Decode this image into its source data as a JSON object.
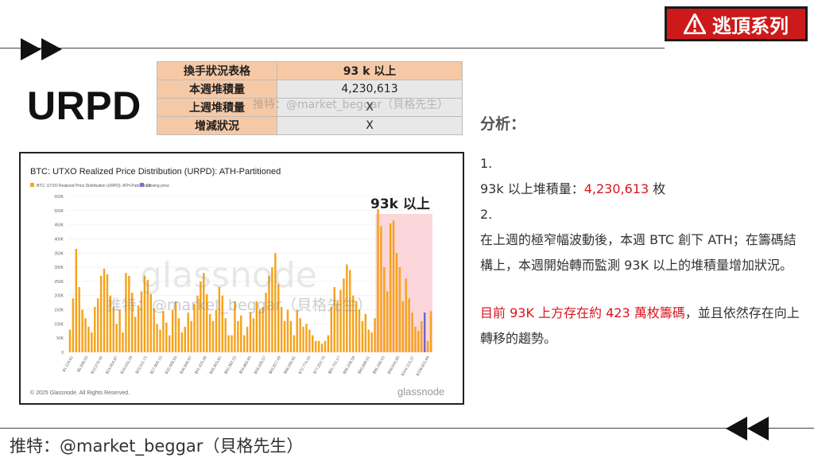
{
  "badge": {
    "text": "逃頂系列",
    "icon": "warning-triangle-icon"
  },
  "page": {
    "title": "URPD"
  },
  "summary_table": {
    "header_label": "換手狀況表格",
    "header_value": "93 k 以上",
    "rows": [
      {
        "label": "本週堆積量",
        "value": "4,230,613"
      },
      {
        "label": "上週堆積量",
        "value": "X"
      },
      {
        "label": "增減狀況",
        "value": "X"
      }
    ]
  },
  "watermarks": {
    "table": "推特：@market_beggar（貝格先生）",
    "chart": "推特：@market_beggar（貝格先生）",
    "chart_logo": "glassnode"
  },
  "chart_data": {
    "type": "bar",
    "title": "BTC: UTXO Realized Price Distribution (URPD): ATH-Partitioned",
    "legend": [
      "BTC: UTXO Realized Price Distribution (URPD): ATH-Partitioned",
      "Closing price"
    ],
    "highlight_label": "93k 以上",
    "ylim": [
      0,
      550000
    ],
    "y_ticks": [
      "0",
      "50K",
      "100K",
      "150K",
      "200K",
      "250K",
      "300K",
      "350K",
      "400K",
      "450K",
      "500K",
      "550K"
    ],
    "x_tick_labels": [
      "$1,119.61",
      "$5,598.03",
      "$10,076.45",
      "$14,554.87",
      "$19,033.29",
      "$23,511.71",
      "$27,990.13",
      "$32,468.55",
      "$36,946.97",
      "$41,425.39",
      "$45,903.81",
      "$50,382.23",
      "$54,860.65",
      "$59,339.07",
      "$63,817.49",
      "$68,295.91",
      "$72,774.33",
      "$77,252.75",
      "$81,731.17",
      "$86,209.59",
      "$90,688.01",
      "$95,166.43",
      "$99,644.85",
      "$104,123.27",
      "$108,601.69"
    ],
    "values": [
      80000,
      190000,
      365000,
      230000,
      150000,
      120000,
      90000,
      70000,
      160000,
      190000,
      270000,
      295000,
      275000,
      200000,
      160000,
      100000,
      150000,
      70000,
      280000,
      270000,
      210000,
      125000,
      165000,
      215000,
      270000,
      255000,
      205000,
      155000,
      100000,
      80000,
      145000,
      105000,
      60000,
      150000,
      180000,
      120000,
      70000,
      90000,
      140000,
      110000,
      170000,
      200000,
      250000,
      280000,
      205000,
      135000,
      110000,
      150000,
      230000,
      200000,
      120000,
      60000,
      60000,
      180000,
      110000,
      130000,
      60000,
      90000,
      140000,
      120000,
      180000,
      150000,
      160000,
      210000,
      270000,
      300000,
      350000,
      240000,
      160000,
      110000,
      150000,
      110000,
      60000,
      150000,
      120000,
      90000,
      100000,
      80000,
      60000,
      40000,
      40000,
      30000,
      40000,
      60000,
      160000,
      230000,
      180000,
      220000,
      260000,
      310000,
      290000,
      200000,
      180000,
      150000,
      110000,
      135000,
      80000,
      70000,
      120000,
      505000,
      445000,
      300000,
      215000,
      455000,
      465000,
      350000,
      300000,
      180000,
      260000,
      190000,
      140000,
      90000,
      75000,
      110000,
      140000,
      40000,
      145000
    ],
    "highlight_from_index": 99,
    "special_bar_index": 114,
    "footer_left": "© 2025 Glassnode. All Rights Reserved.",
    "footer_right": "glassnode"
  },
  "analysis": {
    "heading": "分析：",
    "item1_number": "1.",
    "item1_prefix": "93k 以上堆積量：",
    "item1_value": "4,230,613",
    "item1_suffix": " 枚",
    "item2_number": "2.",
    "item2_text": "在上週的極窄幅波動後，本週 BTC 創下 ATH；在籌碼結構上，本週開始轉而監測 93K 以上的堆積量增加狀況。",
    "conclusion_red": "目前 93K 上方存在約 423 萬枚籌碼",
    "conclusion_rest": "，並且依然存在向上轉移的趨勢。"
  },
  "footer": {
    "handle": "推特：@market_beggar（貝格先生）"
  }
}
